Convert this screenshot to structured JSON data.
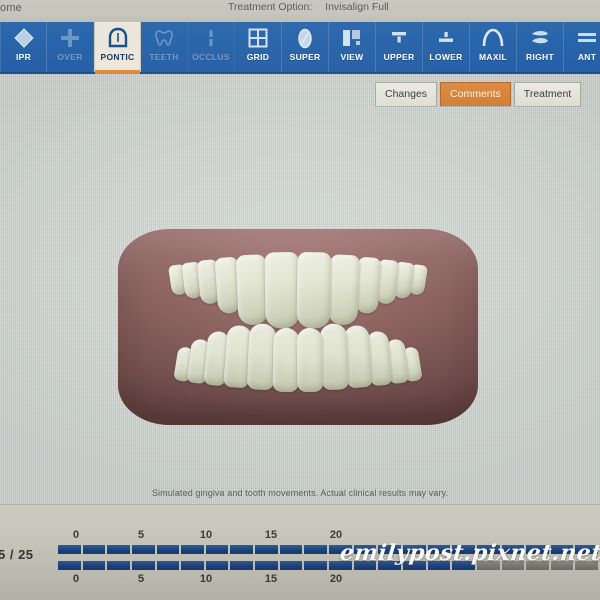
{
  "window": {
    "home_label": "ome",
    "treatment_option_label": "Treatment Option:",
    "treatment_option_value": "Invisalign Full"
  },
  "toolbar": {
    "items": [
      {
        "label": "IPR",
        "icon": "diamond-icon",
        "state": "enabled"
      },
      {
        "label": "OVER",
        "icon": "plus-cross-icon",
        "state": "disabled"
      },
      {
        "label": "PONTIC",
        "icon": "pontic-arch-icon",
        "state": "selected"
      },
      {
        "label": "TEETH",
        "icon": "tooth-outline-icon",
        "state": "disabled"
      },
      {
        "label": "OCCLUS",
        "icon": "occlusion-icon",
        "state": "disabled"
      },
      {
        "label": "GRID",
        "icon": "grid-icon",
        "state": "enabled"
      },
      {
        "label": "SUPER",
        "icon": "superimpose-icon",
        "state": "enabled"
      },
      {
        "label": "VIEW",
        "icon": "view-panels-icon",
        "state": "enabled"
      },
      {
        "label": "UPPER",
        "icon": "upper-arch-icon",
        "state": "enabled"
      },
      {
        "label": "LOWER",
        "icon": "lower-arch-icon",
        "state": "enabled"
      },
      {
        "label": "MAXIL",
        "icon": "maxillary-arch-icon",
        "state": "enabled"
      },
      {
        "label": "RIGHT",
        "icon": "rotate-right-icon",
        "state": "enabled"
      },
      {
        "label": "ANT",
        "icon": "anterior-view-icon",
        "state": "enabled"
      }
    ]
  },
  "tabs": [
    {
      "label": "Changes",
      "active": false
    },
    {
      "label": "Comments",
      "active": true
    },
    {
      "label": "Treatment",
      "active": false
    }
  ],
  "viewport": {
    "model_name": "dental-arch-3d-model",
    "disclaimer": "Simulated gingiva and tooth movements. Actual clinical results may vary."
  },
  "timeline": {
    "stage_counter": "5 / 25",
    "ticks_top": [
      "0",
      "5",
      "10",
      "15",
      "20"
    ],
    "ticks_bottom": [
      "0",
      "5",
      "10",
      "15",
      "20"
    ],
    "tick_positions_pct": [
      18,
      83,
      148,
      213,
      278
    ],
    "upper_total_segments": 22,
    "upper_active_segments": 22,
    "lower_total_segments": 22,
    "lower_active_segments": 17
  },
  "watermark": {
    "text": "emilypost.pixnet.net"
  },
  "colors": {
    "toolbar_blue": "#2a67ae",
    "selected_tab_orange": "#d07e34",
    "selected_tool_bg": "#ece7da",
    "selected_tool_underline": "#e08a36",
    "viewport_bg": "#ccd2cd",
    "gingiva": "#8f6260",
    "tooth": "#e2e5d2",
    "bar_active": "#1d4480",
    "bar_inactive": "#7b7b73",
    "chrome_bg": "#c6c5ba"
  }
}
